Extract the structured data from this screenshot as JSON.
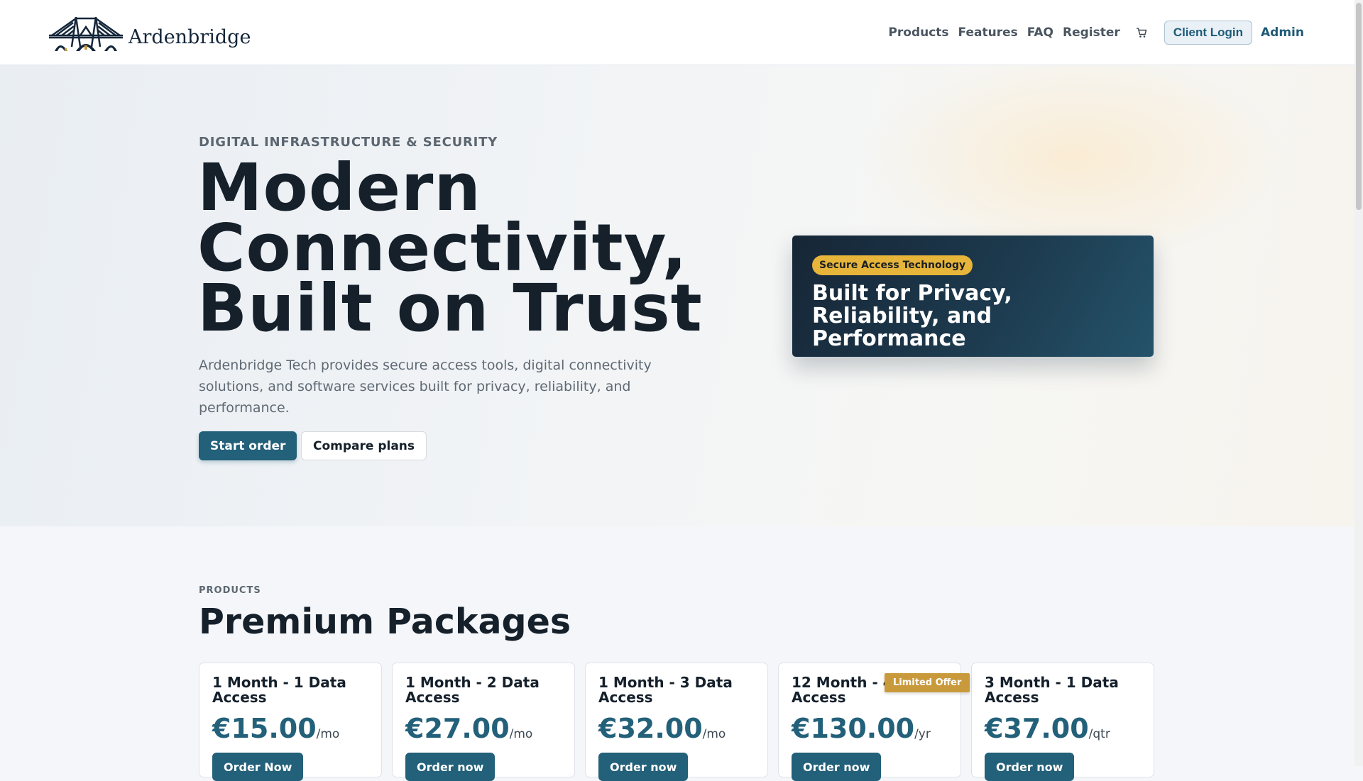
{
  "brand": {
    "name": "Ardenbridge"
  },
  "nav": {
    "links": [
      "Products",
      "Features",
      "FAQ",
      "Register"
    ],
    "cart_icon": "cart-icon",
    "login_label": "Client Login",
    "admin_label": "Admin"
  },
  "hero": {
    "eyebrow": "DIGITAL INFRASTRUCTURE & SECURITY",
    "title_lines": [
      "Modern",
      "Connectivity,",
      "Built on Trust"
    ],
    "description": "Ardenbridge Tech provides secure access tools, digital connectivity solutions, and software services built for privacy, reliability, and performance.",
    "primary_cta": "Start order",
    "secondary_cta": "Compare plans",
    "card": {
      "badge": "Secure Access Technology",
      "title": "Built for Privacy, Reliability, and Performance"
    }
  },
  "products": {
    "eyebrow": "PRODUCTS",
    "title": "Premium Packages",
    "items": [
      {
        "name": "1 Month - 1 Data Access",
        "price": "€15.00",
        "period": "/mo",
        "cta": "Order Now"
      },
      {
        "name": "1 Month - 2 Data Access",
        "price": "€27.00",
        "period": "/mo",
        "cta": "Order now"
      },
      {
        "name": "1 Month - 3 Data Access",
        "price": "€32.00",
        "period": "/mo",
        "cta": "Order now"
      },
      {
        "name": "12 Month - 4 Data Access",
        "price": "€130.00",
        "period": "/yr",
        "cta": "Order now",
        "badge": "Limited Offer"
      },
      {
        "name": "3 Month - 1 Data Access",
        "price": "€37.00",
        "period": "/qtr",
        "cta": "Order now"
      }
    ]
  },
  "colors": {
    "accent": "#236079",
    "badge_gold": "#e6b53a",
    "offer_gold": "#c99a3c",
    "hero_card": "#1d3a4e"
  }
}
